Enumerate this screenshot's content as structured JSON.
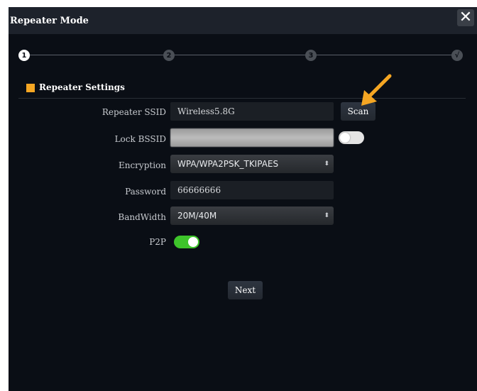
{
  "dialog": {
    "title": "Repeater Mode",
    "close_icon": "close-icon"
  },
  "steps": [
    "1",
    "2",
    "3",
    "√"
  ],
  "section": {
    "title": "Repeater Settings"
  },
  "form": {
    "ssid_label": "Repeater SSID",
    "ssid_value": "Wireless5.8G",
    "scan_label": "Scan",
    "lock_bssid_label": "Lock BSSID",
    "lock_bssid_value": "",
    "lock_bssid_enabled": false,
    "encryption_label": "Encryption",
    "encryption_value": "WPA/WPA2PSK_TKIPAES",
    "password_label": "Password",
    "password_value": "66666666",
    "bandwidth_label": "BandWidth",
    "bandwidth_value": "20M/40M",
    "p2p_label": "P2P",
    "p2p_enabled": true
  },
  "next_label": "Next",
  "colors": {
    "accent": "#f5a623",
    "toggle_on": "#3ec42b",
    "toggle_off": "#e4e4e4",
    "dialog_bg": "#0a0e15"
  }
}
